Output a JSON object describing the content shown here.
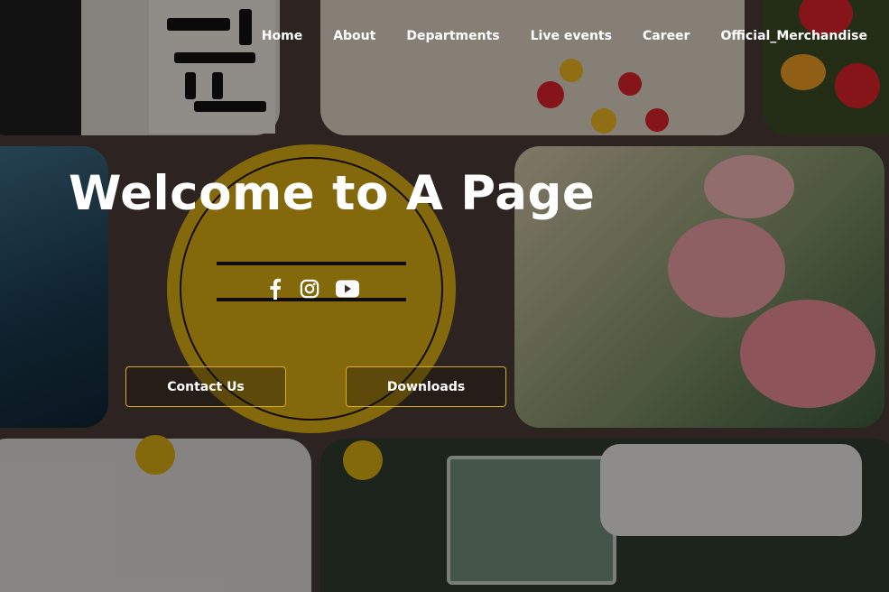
{
  "nav": {
    "items": [
      {
        "label": "Home"
      },
      {
        "label": "About"
      },
      {
        "label": "Departments"
      },
      {
        "label": "Live events"
      },
      {
        "label": "Career"
      },
      {
        "label": "Official_Merchandise"
      }
    ]
  },
  "hero": {
    "title": "Welcome to A Page",
    "socials": [
      {
        "icon": "facebook-icon"
      },
      {
        "icon": "instagram-icon"
      },
      {
        "icon": "youtube-icon"
      }
    ],
    "buttons": {
      "contact_label": "Contact Us",
      "downloads_label": "Downloads"
    }
  },
  "colors": {
    "accent_border": "#d9ad1f",
    "text": "#ffffff"
  }
}
